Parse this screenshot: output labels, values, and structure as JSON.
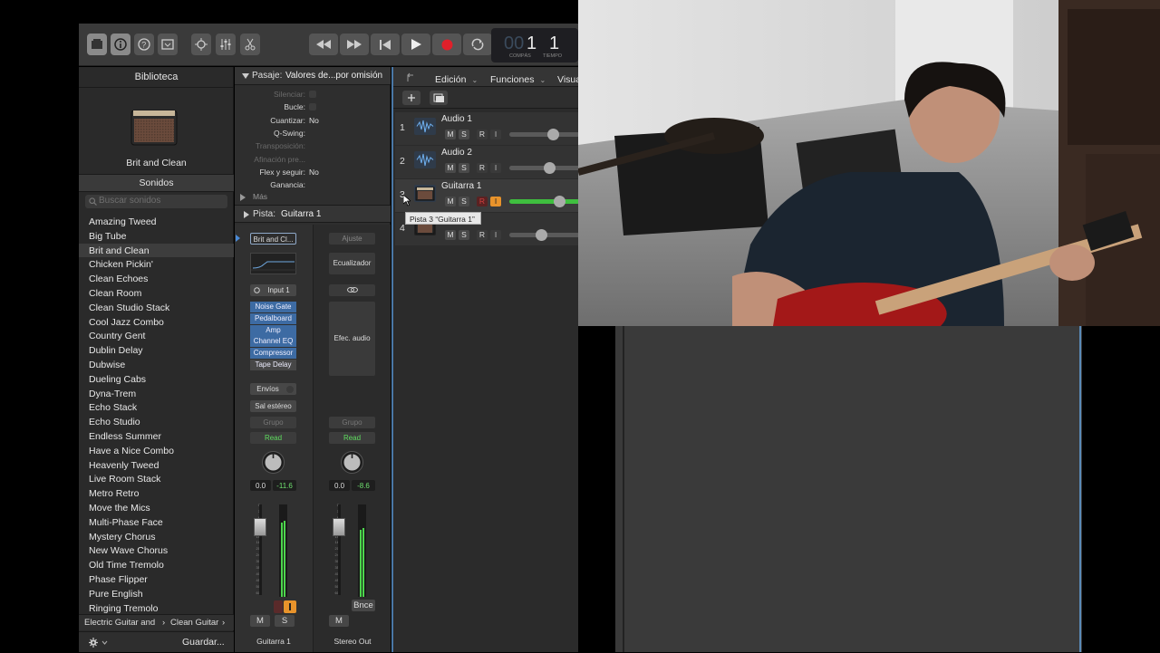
{
  "toolbar": {
    "lcd_bar": "001",
    "lcd_bar_label": "COMPÁS",
    "lcd_beat": "1",
    "lcd_beat_label": "TIEMPO"
  },
  "library": {
    "title": "Biblioteca",
    "preset_name": "Brit and Clean",
    "sounds_header": "Sonidos",
    "search_placeholder": "Buscar sonidos",
    "items": [
      "Amazing Tweed",
      "Big Tube",
      "Brit and Clean",
      "Chicken Pickin'",
      "Clean Echoes",
      "Clean Room",
      "Clean Studio Stack",
      "Cool Jazz Combo",
      "Country Gent",
      "Dublin Delay",
      "Dubwise",
      "Dueling Cabs",
      "Dyna-Trem",
      "Echo Stack",
      "Echo Studio",
      "Endless Summer",
      "Have a Nice Combo",
      "Heavenly Tweed",
      "Live Room Stack",
      "Metro Retro",
      "Move the Mics",
      "Multi-Phase Face",
      "Mystery Chorus",
      "New Wave Chorus",
      "Old Time Tremolo",
      "Phase Flipper",
      "Pure English",
      "Ringing Tremolo"
    ],
    "breadcrumb_1": "Electric Guitar and",
    "breadcrumb_sep": "›",
    "breadcrumb_2": "Clean Guitar",
    "breadcrumb_end": "›",
    "save_label": "Guardar..."
  },
  "inspector": {
    "region_header_label": "Pasaje:",
    "region_header_value": "Valores de...por omisión",
    "rows": [
      {
        "label": "Silenciar:",
        "value": ""
      },
      {
        "label": "Bucle:",
        "value": ""
      },
      {
        "label": "Cuantizar:",
        "value": "No"
      },
      {
        "label": "Q-Swing:",
        "value": ""
      },
      {
        "label": "Transposición:",
        "value": ""
      },
      {
        "label": "Afinación pre...",
        "value": ""
      },
      {
        "label": "Flex y seguir:",
        "value": "No"
      },
      {
        "label": "Ganancia:",
        "value": ""
      }
    ],
    "more_label": "Más",
    "track_header_label": "Pista:",
    "track_header_value": "Guitarra 1",
    "strip1": {
      "setting": "Brit and Cl...",
      "input": "Input 1",
      "plugins": [
        "Noise Gate",
        "Pedalboard",
        "Amp",
        "Channel EQ",
        "Compressor",
        "Tape Delay"
      ],
      "sends": "Envíos",
      "output": "Sal estéreo",
      "group": "Grupo",
      "automation": "Read",
      "vol": "0.0",
      "peak": "-11.6",
      "mute": "M",
      "solo": "S",
      "name": "Guitarra 1"
    },
    "strip2": {
      "setting": "Ajuste",
      "eq": "Ecualizador",
      "fx": "Efec. audio",
      "group": "Grupo",
      "automation": "Read",
      "vol": "0.0",
      "peak": "-8.6",
      "mute": "M",
      "bounce": "Bnce",
      "name": "Stereo Out"
    },
    "fader_scale": [
      "0",
      "3",
      "6",
      "9",
      "12",
      "15",
      "18",
      "21",
      "24",
      "30",
      "35",
      "40",
      "45",
      "50",
      "60"
    ]
  },
  "tracks_area": {
    "menu": [
      "Edición",
      "Funciones",
      "Visua"
    ],
    "tracks": [
      {
        "num": "1",
        "name": "Audio 1",
        "m": "M",
        "s": "S",
        "r": "R",
        "i": "I",
        "vol": 0.62
      },
      {
        "num": "2",
        "name": "Audio 2",
        "m": "M",
        "s": "S",
        "r": "R",
        "i": "I",
        "vol": 0.56
      },
      {
        "num": "3",
        "name": "Guitarra 1",
        "m": "M",
        "s": "S",
        "r": "R",
        "i": "I",
        "vol": 0.7
      },
      {
        "num": "4",
        "name": "ive",
        "m": "M",
        "s": "S",
        "r": "R",
        "i": "I",
        "vol": 0.45
      }
    ],
    "tooltip": "Pista 3 “Guitarra 1”"
  },
  "colors": {
    "accent_blue": "#3d6ba3",
    "record": "#e0202a",
    "read_green": "#5fdc5f",
    "input_orange": "#e8932b"
  }
}
